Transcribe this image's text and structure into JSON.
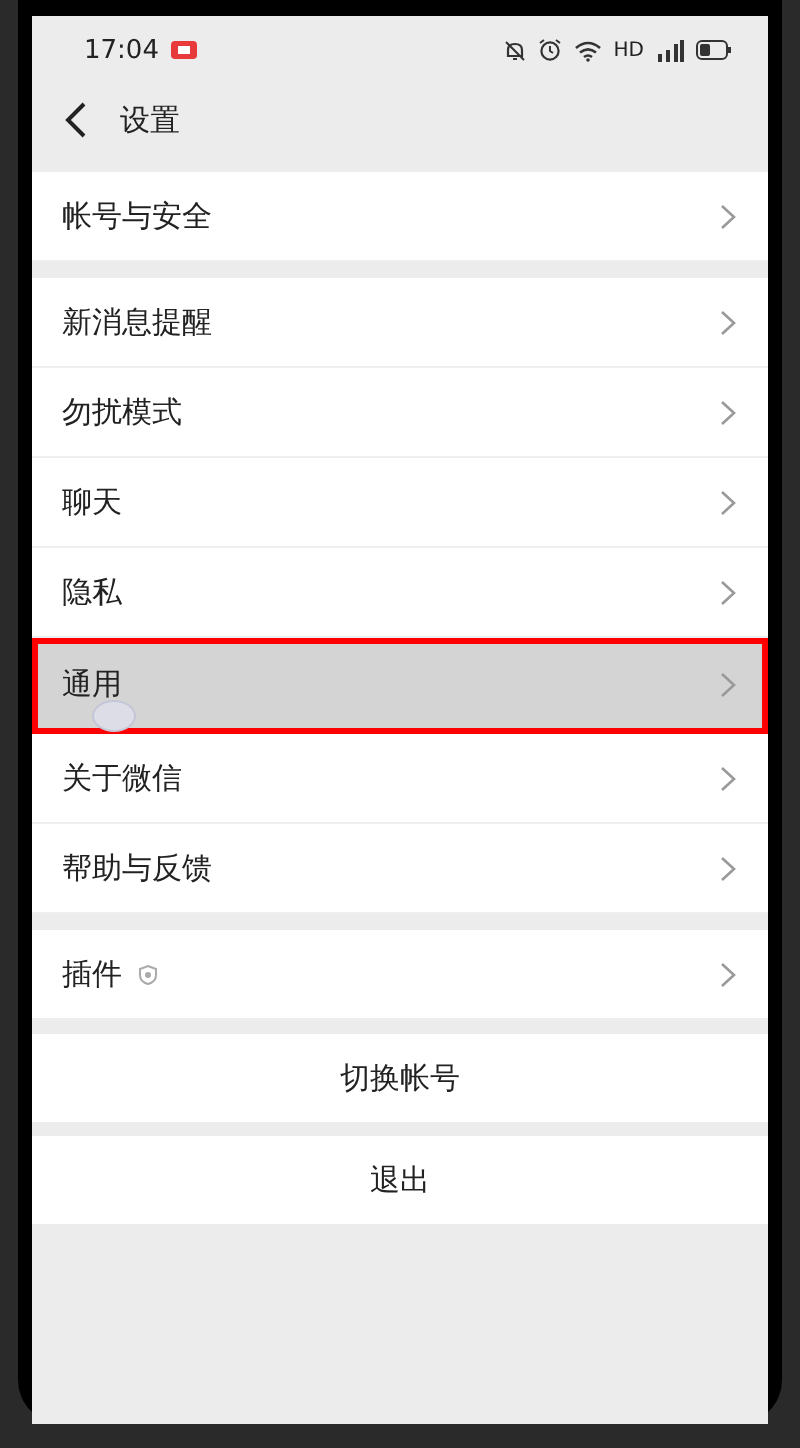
{
  "status_bar": {
    "time": "17:04",
    "network": "HD"
  },
  "header": {
    "title": "设置"
  },
  "groups": [
    {
      "items": [
        {
          "label": "帐号与安全",
          "kind": "plain",
          "selected": false
        }
      ]
    },
    {
      "items": [
        {
          "label": "新消息提醒",
          "kind": "plain",
          "selected": false
        },
        {
          "label": "勿扰模式",
          "kind": "plain",
          "selected": false
        },
        {
          "label": "聊天",
          "kind": "plain",
          "selected": false
        },
        {
          "label": "隐私",
          "kind": "plain",
          "selected": false
        },
        {
          "label": "通用",
          "kind": "plain",
          "selected": true
        },
        {
          "label": "关于微信",
          "kind": "plain",
          "selected": false
        },
        {
          "label": "帮助与反馈",
          "kind": "plain",
          "selected": false
        }
      ]
    },
    {
      "items": [
        {
          "label": "插件",
          "kind": "shield",
          "selected": false
        }
      ]
    }
  ],
  "buttons": [
    {
      "label": "切换帐号"
    },
    {
      "label": "退出"
    }
  ]
}
